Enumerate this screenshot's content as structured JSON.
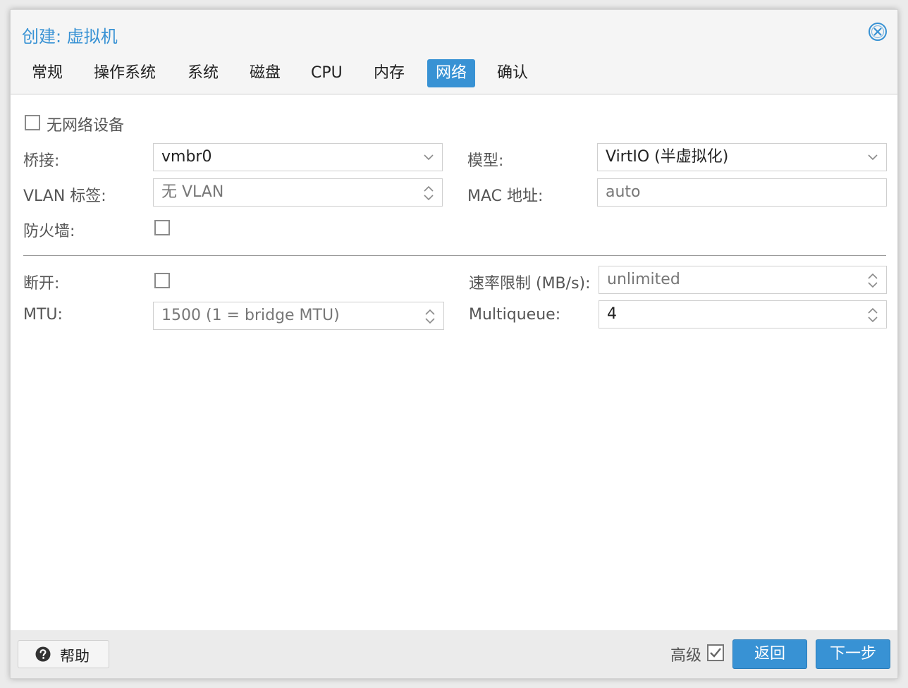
{
  "window": {
    "title": "创建: 虚拟机"
  },
  "tabs": [
    {
      "label": "常规"
    },
    {
      "label": "操作系统"
    },
    {
      "label": "系统"
    },
    {
      "label": "磁盘"
    },
    {
      "label": "CPU"
    },
    {
      "label": "内存"
    },
    {
      "label": "网络",
      "active": true
    },
    {
      "label": "确认"
    }
  ],
  "form": {
    "no_network_label": "无网络设备",
    "bridge_label": "桥接:",
    "bridge_value": "vmbr0",
    "model_label": "模型:",
    "model_value": "VirtIO (半虚拟化)",
    "vlan_label": "VLAN 标签:",
    "vlan_placeholder": "无 VLAN",
    "mac_label": "MAC 地址:",
    "mac_placeholder": "auto",
    "firewall_label": "防火墙:",
    "disconnect_label": "断开:",
    "rate_label": "速率限制 (MB/s):",
    "rate_placeholder": "unlimited",
    "mtu_label": "MTU:",
    "mtu_placeholder": "1500 (1 = bridge MTU)",
    "multiqueue_label": "Multiqueue:",
    "multiqueue_value": "4"
  },
  "footer": {
    "help_label": "帮助",
    "advanced_label": "高级",
    "advanced_checked": true,
    "back_label": "返回",
    "next_label": "下一步"
  },
  "colors": {
    "accent": "#3892d4"
  },
  "icons": [
    "close-icon",
    "chevron-down-icon",
    "spinner-icon",
    "help-icon",
    "checkbox-checked-icon"
  ]
}
